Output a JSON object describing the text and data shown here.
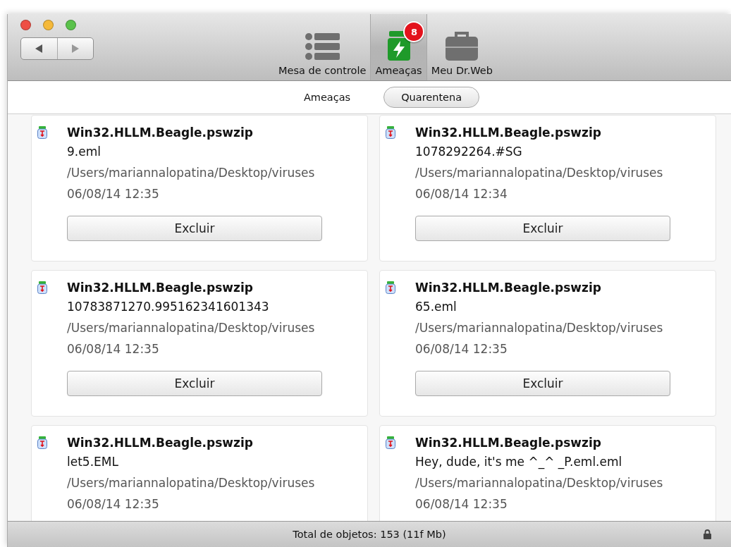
{
  "toolbar": {
    "items": [
      {
        "kind": "list",
        "label": "Mesa de controle",
        "selected": false
      },
      {
        "kind": "threats",
        "label": "Ameaças",
        "selected": true,
        "badge": "8"
      },
      {
        "kind": "case",
        "label": "Meu Dr.Web",
        "selected": false
      }
    ]
  },
  "tabs": [
    {
      "label": "Ameaças",
      "selected": false
    },
    {
      "label": "Quarentena",
      "selected": true
    }
  ],
  "items": [
    {
      "threat": "Win32.HLLM.Beagle.pswzip",
      "file": "9.eml",
      "path": "/Users/mariannalopatina/Desktop/viruses",
      "date": "06/08/14 12:35",
      "button": "Excluir"
    },
    {
      "threat": "Win32.HLLM.Beagle.pswzip",
      "file": "1078292264.#SG",
      "path": "/Users/mariannalopatina/Desktop/viruses",
      "date": "06/08/14 12:34",
      "button": "Excluir"
    },
    {
      "threat": "Win32.HLLM.Beagle.pswzip",
      "file": "10783871270.995162341601343",
      "path": "/Users/mariannalopatina/Desktop/viruses",
      "date": "06/08/14 12:35",
      "button": "Excluir"
    },
    {
      "threat": "Win32.HLLM.Beagle.pswzip",
      "file": "65.eml",
      "path": "/Users/mariannalopatina/Desktop/viruses",
      "date": "06/08/14 12:35",
      "button": "Excluir"
    },
    {
      "threat": "Win32.HLLM.Beagle.pswzip",
      "file": "let5.EML",
      "path": "/Users/mariannalopatina/Desktop/viruses",
      "date": "06/08/14 12:35"
    },
    {
      "threat": "Win32.HLLM.Beagle.pswzip",
      "file": "Hey, dude, it's me ^_^ _P.eml.eml",
      "path": "/Users/mariannalopatina/Desktop/viruses",
      "date": "06/08/14 12:35"
    }
  ],
  "status_bar": {
    "text": "Total de objetos: 153 (11f Mb)",
    "locked": true
  }
}
